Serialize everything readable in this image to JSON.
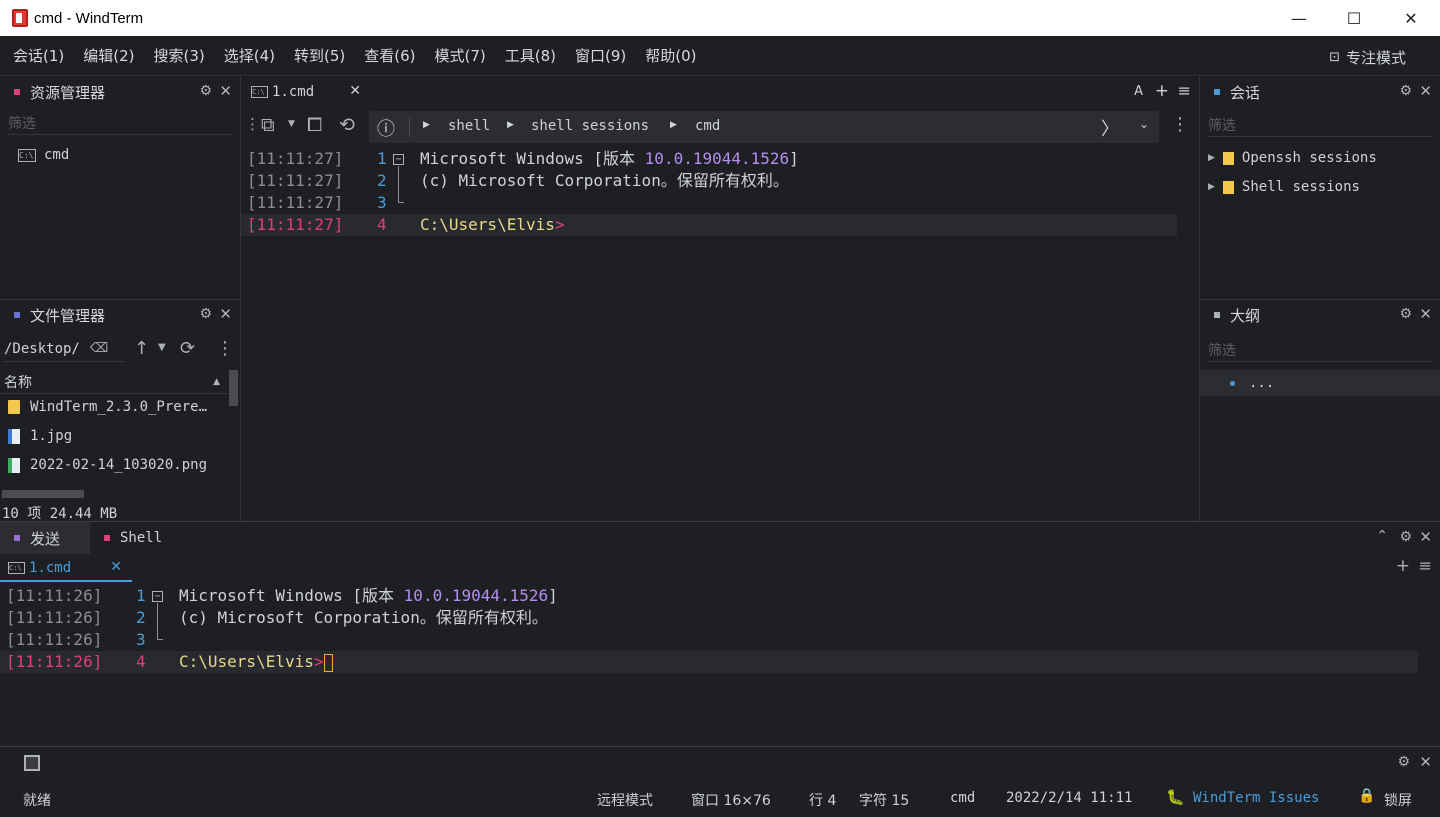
{
  "window": {
    "title": "cmd - WindTerm"
  },
  "menu": [
    "会话(1)",
    "编辑(2)",
    "搜索(3)",
    "选择(4)",
    "转到(5)",
    "查看(6)",
    "模式(7)",
    "工具(8)",
    "窗口(9)",
    "帮助(0)"
  ],
  "focus_mode": "专注模式",
  "explorer": {
    "title": "资源管理器",
    "filter_placeholder": "筛选",
    "items": [
      "cmd"
    ]
  },
  "file_manager": {
    "title": "文件管理器",
    "path": "/Desktop/",
    "column_name": "名称",
    "files": [
      "WindTerm_2.3.0_Prere…",
      "1.jpg",
      "2022-02-14_103020.png"
    ],
    "summary": "10 项 24.44 MB"
  },
  "main_tab": {
    "label": "1.cmd",
    "font_btn": "A"
  },
  "breadcrumb": [
    "shell",
    "shell sessions",
    "cmd"
  ],
  "terminal": {
    "lines": [
      {
        "ts": "[11:11:27]",
        "num": "1",
        "text_a": "Microsoft Windows [版本 ",
        "version": "10.0.19044.1526",
        "text_b": "]"
      },
      {
        "ts": "[11:11:27]",
        "num": "2",
        "text": "(c) Microsoft Corporation。保留所有权利。"
      },
      {
        "ts": "[11:11:27]",
        "num": "3",
        "text": ""
      },
      {
        "ts": "[11:11:27]",
        "num": "4",
        "prompt": "C:\\Users\\Elvis",
        "gt": ">"
      }
    ]
  },
  "sessions": {
    "title": "会话",
    "filter_placeholder": "筛选",
    "items": [
      "Openssh sessions",
      "Shell sessions"
    ]
  },
  "outline": {
    "title": "大纲",
    "filter_placeholder": "筛选",
    "item": "..."
  },
  "bottom": {
    "tabs": [
      "发送",
      "Shell"
    ],
    "subtab": "1.cmd",
    "lines": [
      {
        "ts": "[11:11:26]",
        "num": "1",
        "text_a": "Microsoft Windows [版本 ",
        "version": "10.0.19044.1526",
        "text_b": "]"
      },
      {
        "ts": "[11:11:26]",
        "num": "2",
        "text": "(c) Microsoft Corporation。保留所有权利。"
      },
      {
        "ts": "[11:11:26]",
        "num": "3",
        "text": ""
      },
      {
        "ts": "[11:11:26]",
        "num": "4",
        "prompt": "C:\\Users\\Elvis",
        "gt": ">"
      }
    ]
  },
  "status": {
    "ready": "就绪",
    "remote_mode": "远程模式",
    "window_size": "窗口 16×76",
    "line": "行 4",
    "char": "字符 15",
    "session": "cmd",
    "datetime": "2022/2/14 11:11",
    "issues": "WindTerm Issues",
    "lock": "锁屏"
  },
  "colors": {
    "accent": "#4c9bd6",
    "pink": "#e0407a",
    "folder": "#f2c94c"
  }
}
